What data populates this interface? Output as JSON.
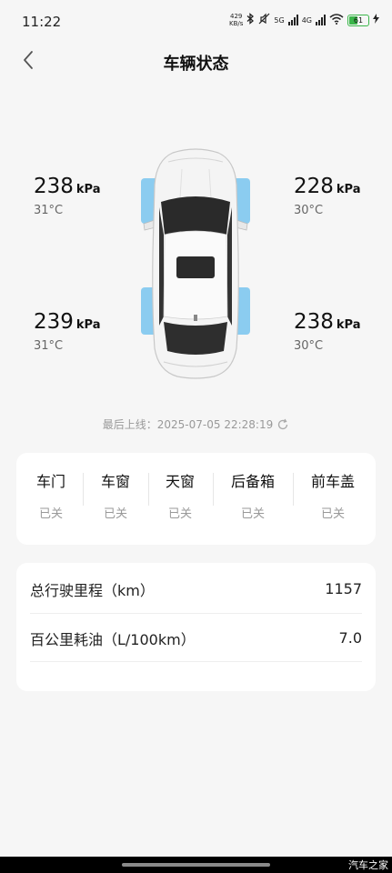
{
  "status_bar": {
    "time": "11:22",
    "net_speed_value": "429",
    "net_speed_unit": "KB/s",
    "net_1": "5G",
    "net_2": "4G",
    "battery": "61",
    "icons": [
      "bluetooth-icon",
      "mute-icon",
      "signal-icon",
      "wifi-icon",
      "battery-icon",
      "charging-icon"
    ]
  },
  "header": {
    "title": "车辆状态",
    "back_icon": "chevron-left-icon"
  },
  "tires": {
    "front_left": {
      "pressure": "238",
      "unit": "kPa",
      "temp": "31°C"
    },
    "front_right": {
      "pressure": "228",
      "unit": "kPa",
      "temp": "30°C"
    },
    "rear_left": {
      "pressure": "239",
      "unit": "kPa",
      "temp": "31°C"
    },
    "rear_right": {
      "pressure": "238",
      "unit": "kPa",
      "temp": "30°C"
    }
  },
  "last_online": "最后上线：2025-07-05 22:28:19",
  "status_items": [
    {
      "name": "车门",
      "value": "已关"
    },
    {
      "name": "车窗",
      "value": "已关"
    },
    {
      "name": "天窗",
      "value": "已关"
    },
    {
      "name": "后备箱",
      "value": "已关"
    },
    {
      "name": "前车盖",
      "value": "已关"
    }
  ],
  "stats": [
    {
      "label": "总行驶里程（km）",
      "value": "1157"
    },
    {
      "label": "百公里耗油（L/100km）",
      "value": "7.0"
    }
  ],
  "watermark": "汽车之家",
  "colors": {
    "tire_highlight": "#7fc8f0",
    "battery": "#3bb64a",
    "card_bg": "#ffffff",
    "page_bg": "#f6f6f6"
  }
}
